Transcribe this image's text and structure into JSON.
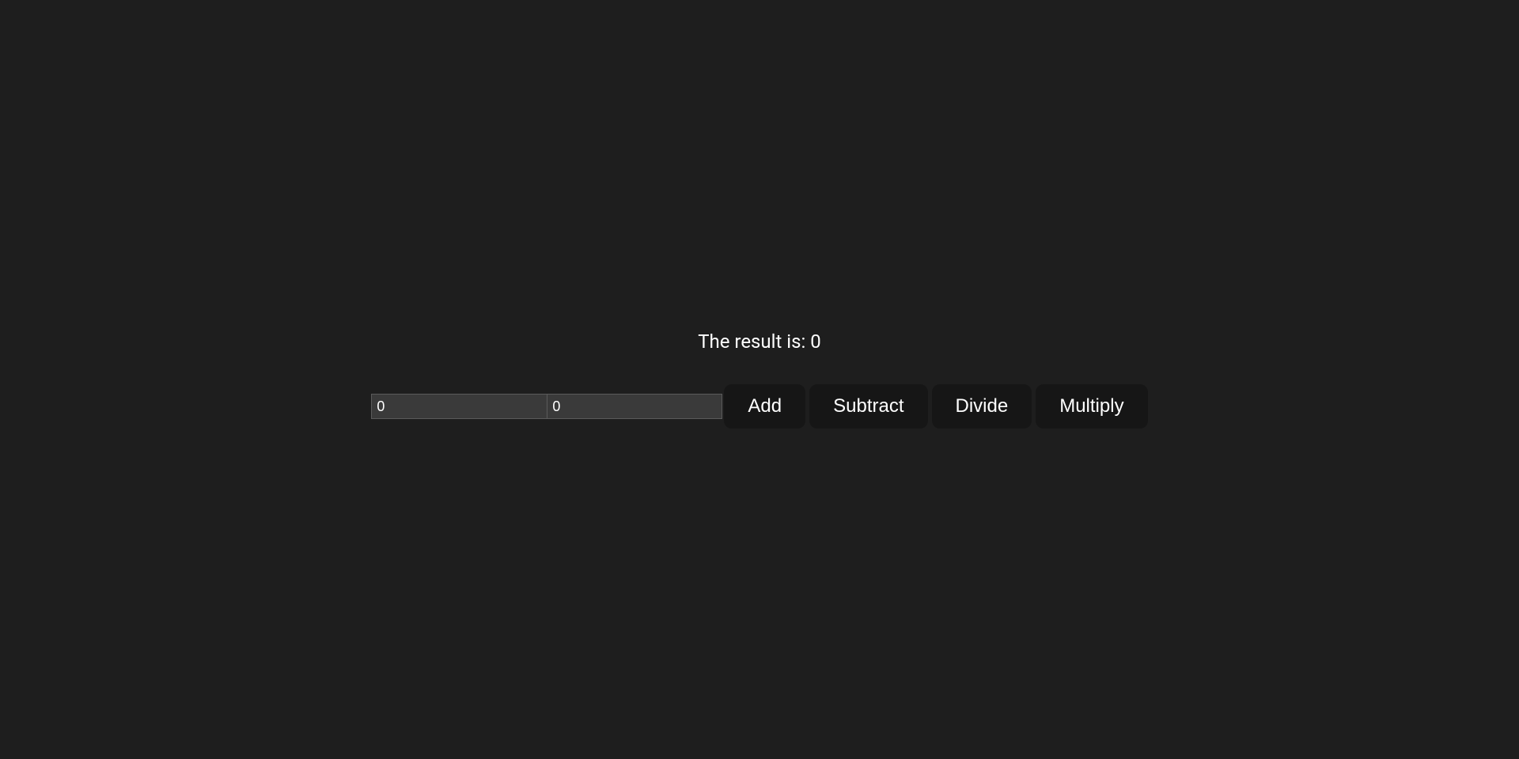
{
  "result": {
    "label": "The result is: ",
    "value": "0"
  },
  "inputs": {
    "first": "0",
    "second": "0"
  },
  "buttons": {
    "add": "Add",
    "subtract": "Subtract",
    "divide": "Divide",
    "multiply": "Multiply"
  }
}
